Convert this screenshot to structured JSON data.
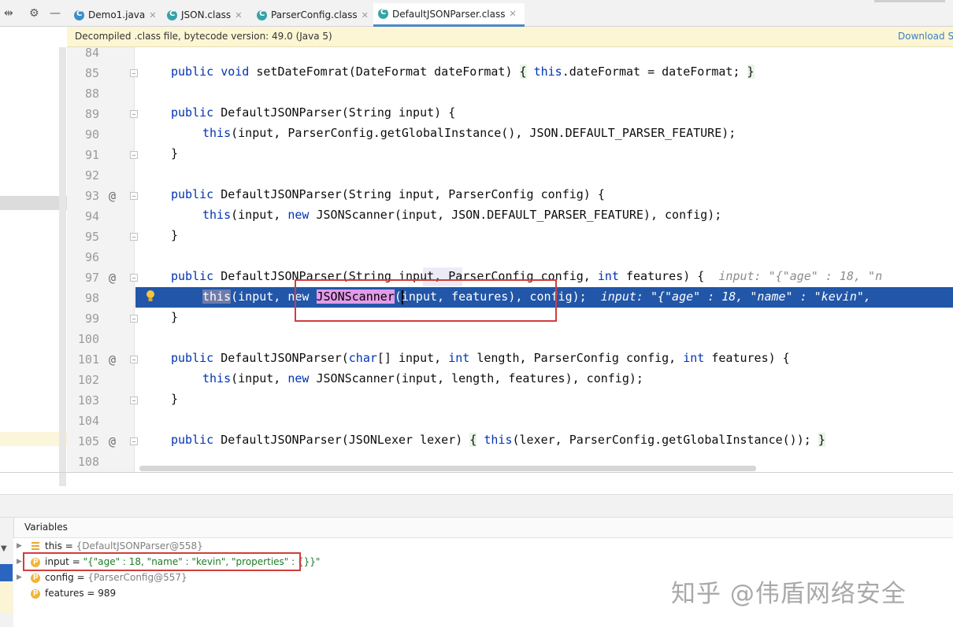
{
  "tabs": [
    {
      "name": "Demo1.java",
      "icon": "java-class-icon"
    },
    {
      "name": "JSON.class",
      "icon": "class-file-icon"
    },
    {
      "name": "ParserConfig.class",
      "icon": "class-file-icon"
    },
    {
      "name": "DefaultJSONParser.class",
      "icon": "class-file-icon",
      "active": true
    }
  ],
  "banner": {
    "message": "Decompiled .class file, bytecode version: 49.0 (Java 5)",
    "link": "Download S"
  },
  "gutter": {
    "line_numbers": [
      "84",
      "85",
      "88",
      "89",
      "90",
      "91",
      "92",
      "93",
      "94",
      "95",
      "96",
      "97",
      "98",
      "99",
      "100",
      "101",
      "102",
      "103",
      "104",
      "105",
      "108"
    ],
    "annotation": "@"
  },
  "code": {
    "l85": {
      "kw1": "public",
      "kw2": "void",
      "t1": " setDateFomrat(DateFormat dateFormat) ",
      "b1": "{",
      "kw3": "this",
      "t2": ".dateFormat = dateFormat; ",
      "b2": "}"
    },
    "l89": {
      "kw1": "public",
      "t1": " DefaultJSONParser(String input) {"
    },
    "l90": {
      "kw1": "this",
      "t1": "(input, ParserConfig.getGlobalInstance(), JSON.DEFAULT_PARSER_FEATURE);"
    },
    "l91": {
      "t1": "}"
    },
    "l93": {
      "kw1": "public",
      "t1": " DefaultJSONParser(String input, ParserConfig config) {"
    },
    "l94": {
      "kw1": "this",
      "t1": "(input, ",
      "kw2": "new",
      "t2": " JSONScanner(input, JSON.DEFAULT_PARSER_FEATURE), config);"
    },
    "l95": {
      "t1": "}"
    },
    "l97": {
      "kw1": "public",
      "t1": " DefaultJSONParser(String input, ParserConfig config, ",
      "kw2": "int",
      "t2": " features) {",
      "hint": "  input: \"{\"age\" : 18, \"n"
    },
    "l98": {
      "kw1": "this",
      "t1": "(input, ",
      "kw2": "new",
      "t2": " ",
      "cls": "JSONScanner",
      "t3": "(",
      "t4": "input, features), config);",
      "hint": "  input: \"{\"age\" : 18, \"name\" : \"kevin\","
    },
    "l99": {
      "t1": "}"
    },
    "l101": {
      "kw1": "public",
      "t1": " DefaultJSONParser(",
      "kw2": "char",
      "t2": "[] input, ",
      "kw3": "int",
      "t3": " length, ParserConfig config, ",
      "kw4": "int",
      "t4": " features) {"
    },
    "l102": {
      "kw1": "this",
      "t1": "(input, ",
      "kw2": "new",
      "t2": " JSONScanner(input, length, features), config);"
    },
    "l103": {
      "t1": "}"
    },
    "l105": {
      "kw1": "public",
      "t1": " DefaultJSONParser(JSONLexer lexer) ",
      "b1": "{",
      "kw2": " this",
      "t2": "(lexer, ParserConfig.getGlobalInstance()); ",
      "b2": "}"
    }
  },
  "variables": {
    "title": "Variables",
    "items": [
      {
        "name": "this",
        "eq": " = ",
        "value": "{DefaultJSONParser@558}"
      },
      {
        "name": "input",
        "eq": " = ",
        "value": "\"{\"age\" : 18, \"name\" : \"kevin\", \"properties\" : {}}\"",
        "badge": "p"
      },
      {
        "name": "config",
        "eq": " = ",
        "value": "{ParserConfig@557}",
        "badge": "p"
      },
      {
        "name": "features",
        "eq": " = ",
        "value": "989",
        "badge": "p"
      }
    ]
  },
  "watermark": "知乎 @伟盾网络安全",
  "colors": {
    "keyword": "#0033b3",
    "current_line": "#2156a8",
    "highlight_box": "#d13d3d",
    "string": "#1d7a26"
  }
}
